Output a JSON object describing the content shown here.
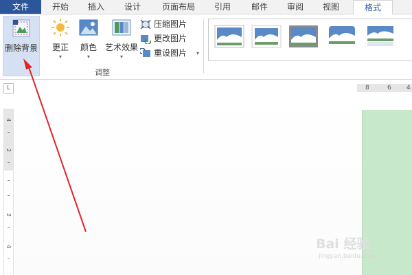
{
  "tabs": [
    {
      "label": "文件",
      "kind": "file"
    },
    {
      "label": "开始"
    },
    {
      "label": "插入"
    },
    {
      "label": "设计"
    },
    {
      "label": "页面布局"
    },
    {
      "label": "引用"
    },
    {
      "label": "邮件"
    },
    {
      "label": "审阅"
    },
    {
      "label": "视图"
    },
    {
      "label": "格式",
      "active": true
    }
  ],
  "ribbon": {
    "remove_background": "删除背景",
    "corrections": "更正",
    "color": "颜色",
    "artistic_effects": "艺术效果",
    "small_buttons": [
      "压缩图片",
      "更改图片",
      "重设图片"
    ],
    "group_label": "调整"
  },
  "ruler": {
    "corner": "L",
    "h_numbers": [
      "8",
      "6",
      "4"
    ],
    "v_numbers": [
      "4",
      "2",
      "2",
      "4"
    ]
  },
  "watermark": {
    "main": "Bai 经验",
    "sub": "jingyan.baidu.com"
  },
  "colors": {
    "file_tab": "#2b579a",
    "selected_button": "#d5e1f2",
    "arrow": "#e02424",
    "page_green": "#c8e8cc"
  }
}
